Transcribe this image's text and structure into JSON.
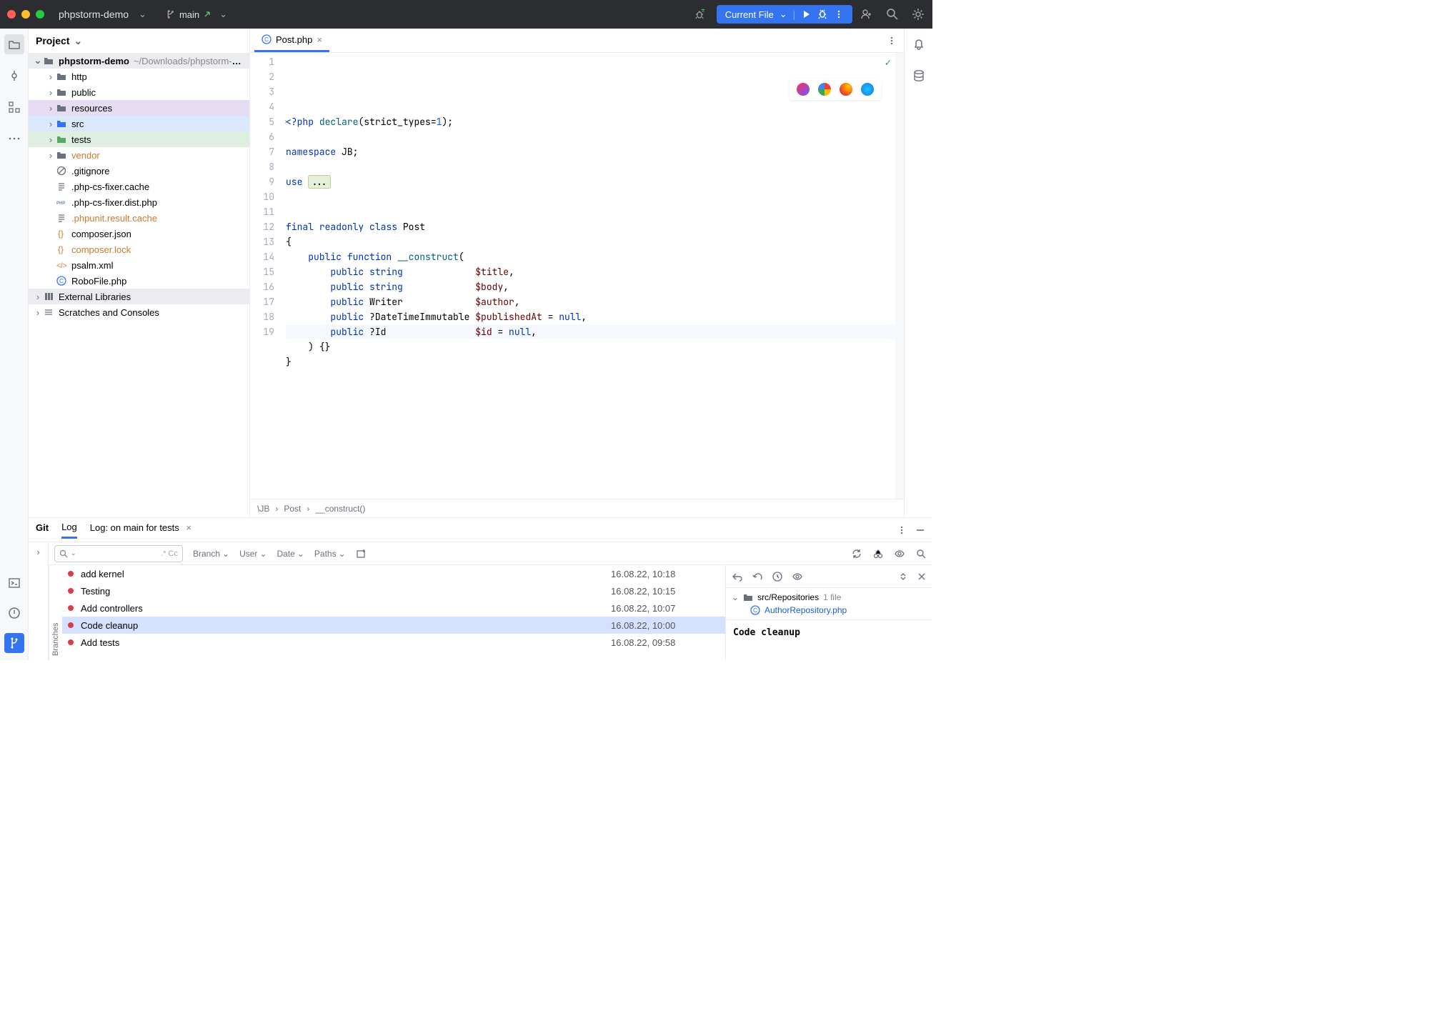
{
  "titlebar": {
    "project": "phpstorm-demo",
    "branch": "main",
    "run_config": "Current File"
  },
  "project_panel": {
    "title": "Project",
    "root": {
      "name": "phpstorm-demo",
      "path": "~/Downloads/phpstorm-demo"
    },
    "children": [
      {
        "name": "http",
        "icon": "folder",
        "depth": 1,
        "arrow": true,
        "cls": ""
      },
      {
        "name": "public",
        "icon": "folder",
        "depth": 1,
        "arrow": true,
        "cls": ""
      },
      {
        "name": "resources",
        "icon": "folder",
        "depth": 1,
        "arrow": true,
        "cls": "sel-resources"
      },
      {
        "name": "src",
        "icon": "folder-src",
        "depth": 1,
        "arrow": true,
        "cls": "sel-src"
      },
      {
        "name": "tests",
        "icon": "folder-tests",
        "depth": 1,
        "arrow": true,
        "cls": "sel-tests"
      },
      {
        "name": "vendor",
        "icon": "folder",
        "depth": 1,
        "arrow": true,
        "cls": "",
        "color": "#c97b2e"
      },
      {
        "name": ".gitignore",
        "icon": "ignore",
        "depth": 1,
        "arrow": false
      },
      {
        "name": ".php-cs-fixer.cache",
        "icon": "text",
        "depth": 1,
        "arrow": false
      },
      {
        "name": ".php-cs-fixer.dist.php",
        "icon": "php",
        "depth": 1,
        "arrow": false
      },
      {
        "name": ".phpunit.result.cache",
        "icon": "text",
        "depth": 1,
        "arrow": false,
        "color": "#c97b2e"
      },
      {
        "name": "composer.json",
        "icon": "json",
        "depth": 1,
        "arrow": false
      },
      {
        "name": "composer.lock",
        "icon": "json",
        "depth": 1,
        "arrow": false,
        "color": "#c97b2e"
      },
      {
        "name": "psalm.xml",
        "icon": "xml",
        "depth": 1,
        "arrow": false
      },
      {
        "name": "RoboFile.php",
        "icon": "class",
        "depth": 1,
        "arrow": false
      }
    ],
    "external": "External Libraries",
    "scratches": "Scratches and Consoles"
  },
  "editor": {
    "tab": {
      "name": "Post.php"
    },
    "lines": [
      {
        "n": 1,
        "html": "<span class='t-kw'>&lt;?php</span> <span class='t-fn'>declare</span>(strict_types=<span class='t-num'>1</span>);"
      },
      {
        "n": 2,
        "html": ""
      },
      {
        "n": 3,
        "html": "<span class='t-kw'>namespace</span> <span class='t-ns'>JB</span>;"
      },
      {
        "n": 4,
        "html": ""
      },
      {
        "n": 5,
        "html": "<span class='t-kw'>use</span> <span class='t-fold'>...</span>"
      },
      {
        "n": 6,
        "html": ""
      },
      {
        "n": 7,
        "html": ""
      },
      {
        "n": 8,
        "html": "<span class='t-kw'>final</span> <span class='t-kw'>readonly</span> <span class='t-kw'>class</span> <span class='t-class'>Post</span>"
      },
      {
        "n": 9,
        "html": "{"
      },
      {
        "n": 10,
        "html": "    <span class='t-kw'>public</span> <span class='t-kw'>function</span> <span class='t-fn'>__construct</span>("
      },
      {
        "n": 11,
        "html": "        <span class='t-kw'>public</span> <span class='t-kw'>string</span>             <span class='t-var'>$title</span>,"
      },
      {
        "n": 12,
        "html": "        <span class='t-kw'>public</span> <span class='t-kw'>string</span>             <span class='t-var'>$body</span>,"
      },
      {
        "n": 13,
        "html": "        <span class='t-kw'>public</span> Writer             <span class='t-var'>$author</span>,"
      },
      {
        "n": 14,
        "html": "        <span class='t-kw'>public</span> ?DateTimeImmutable <span class='t-var'>$publishedAt</span> = <span class='t-kw'>null</span>,"
      },
      {
        "n": 15,
        "html": "        <span class='t-kw'>public</span> ?Id                <span class='t-var'>$id</span> = <span class='t-kw'>null</span>,",
        "cur": true
      },
      {
        "n": 16,
        "html": "    ) {}"
      },
      {
        "n": 17,
        "html": "}"
      },
      {
        "n": 18,
        "html": ""
      },
      {
        "n": 19,
        "html": ""
      }
    ],
    "breadcrumb": [
      "\\JB",
      "Post",
      "__construct()"
    ]
  },
  "git": {
    "label": "Git",
    "tabs": [
      "Log",
      "Log: on main for tests"
    ],
    "filters": [
      "Branch",
      "User",
      "Date",
      "Paths"
    ],
    "branches_label": "Branches",
    "search_trailing": ".*  Cc",
    "commits": [
      {
        "msg": "add kernel",
        "date": "16.08.22, 10:18"
      },
      {
        "msg": "Testing",
        "date": "16.08.22, 10:15"
      },
      {
        "msg": "Add controllers",
        "date": "16.08.22, 10:07"
      },
      {
        "msg": "Code cleanup",
        "date": "16.08.22, 10:00",
        "selected": true
      },
      {
        "msg": "Add tests",
        "date": "16.08.22, 09:58"
      }
    ],
    "detail": {
      "group_path": "src/Repositories",
      "group_count": "1 file",
      "file": "AuthorRepository.php",
      "message": "Code cleanup"
    }
  }
}
